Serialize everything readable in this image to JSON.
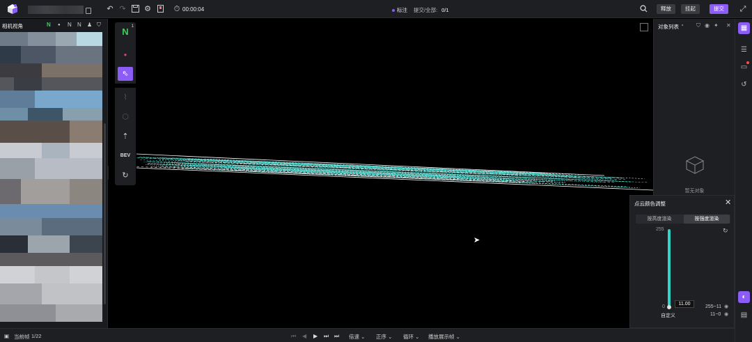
{
  "header": {
    "timer": "00:00:04",
    "mode_label": "标注",
    "submit_label": "提交/全部:",
    "submit_value": "0/1",
    "buttons": {
      "release": "释放",
      "suspend": "挂起",
      "submit": "提交"
    },
    "icons": [
      "undo-icon",
      "redo-icon",
      "save-icon",
      "settings-icon",
      "bookmark-icon",
      "clock-icon",
      "search-icon",
      "fullscreen-icon"
    ]
  },
  "left_panel": {
    "title": "相机视角",
    "icons": [
      "n-icon",
      "dot-icon",
      "n-icon",
      "n-icon",
      "person-icon",
      "funnel-icon"
    ]
  },
  "toolbox": {
    "bev_label": "BEV",
    "n_badge": "1"
  },
  "object_panel": {
    "title": "对象列表",
    "empty_text": "暂无对象"
  },
  "color_panel": {
    "title": "点云颜色调整",
    "tabs": [
      "按高度渲染",
      "按强度渲染"
    ],
    "active_tab": 1,
    "max_label": "255",
    "min_label": "0",
    "current_value": "11.00",
    "custom_label": "自定义",
    "range_high": "255~11",
    "range_low": "11~0",
    "slider_fraction": 1.0,
    "accent_color": "#2fd3c8"
  },
  "footer": {
    "frame_label": "当前帧",
    "frame_value": "1/22",
    "speed_label": "倍速",
    "order_label": "正序",
    "loop_label": "循环",
    "display_label": "播放展示帧"
  },
  "colors": {
    "accent": "#8b5cf6",
    "pointcloud": "#2fd3c8"
  }
}
